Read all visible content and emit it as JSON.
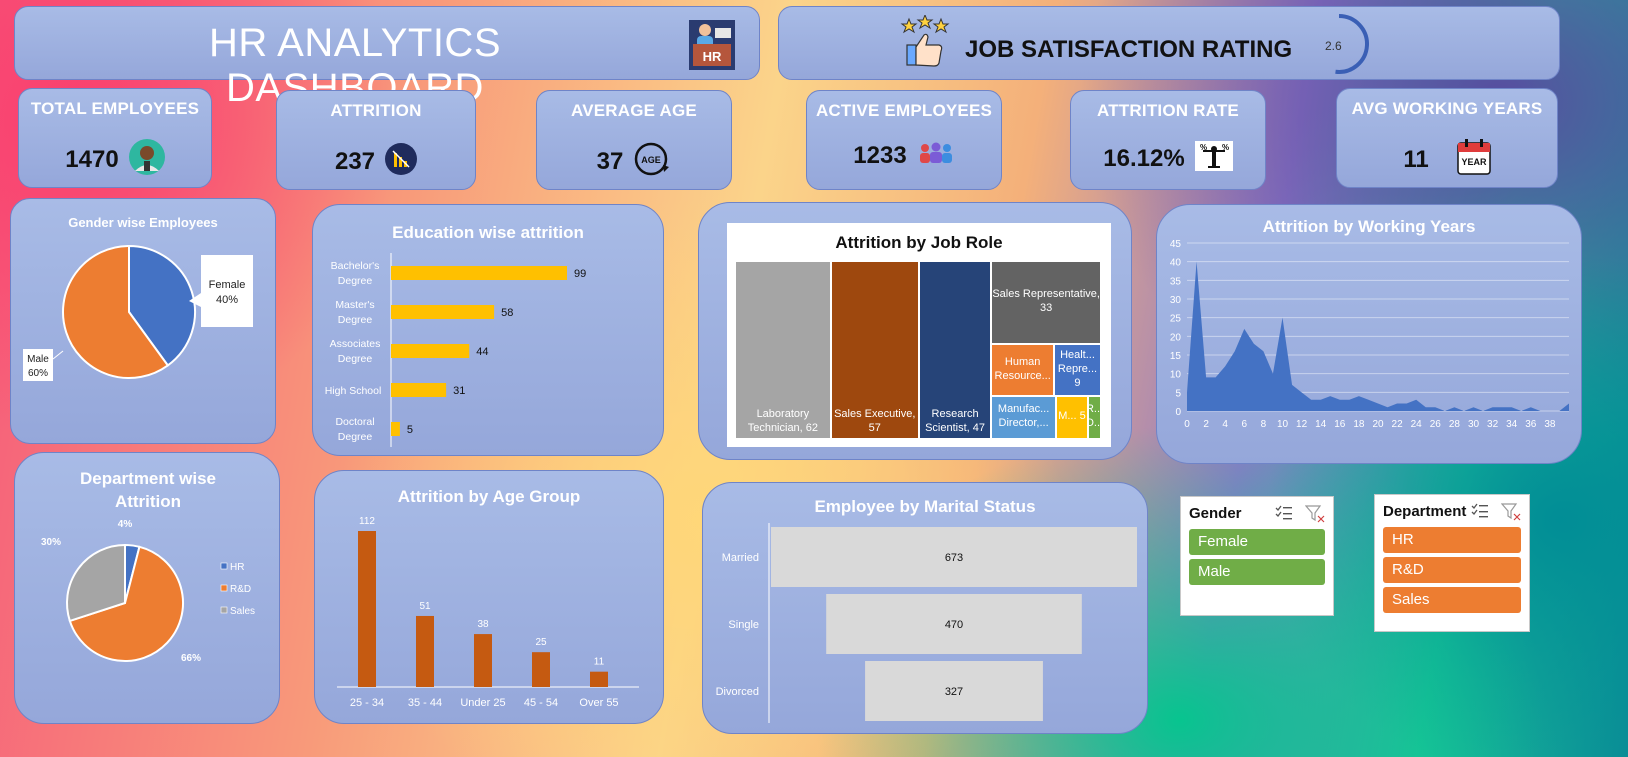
{
  "header": {
    "title": "HR ANALYTICS DASHBOARD",
    "hr_icon_label": "HR",
    "satisfaction_title": "JOB SATISFACTION RATING",
    "satisfaction_value": "2.6",
    "satisfaction_fraction": 0.52
  },
  "kpis": [
    {
      "title": "TOTAL EMPLOYEES",
      "value": "1470",
      "icon": "employee-avatar-icon"
    },
    {
      "title": "ATTRITION",
      "value": "237",
      "icon": "chart-decline-icon"
    },
    {
      "title": "AVERAGE AGE",
      "value": "37",
      "icon": "age-icon",
      "icon_label": "AGE"
    },
    {
      "title": "ACTIVE EMPLOYEES",
      "value": "1233",
      "icon": "people-group-icon"
    },
    {
      "title": "ATTRITION RATE",
      "value": "16.12%",
      "icon": "percent-balance-icon"
    },
    {
      "title": "AVG WORKING YEARS",
      "value": "11",
      "icon": "calendar-year-icon",
      "icon_label": "YEAR"
    }
  ],
  "colors": {
    "blue": "#4472c4",
    "orange": "#ed7d31",
    "gray": "#a5a5a5",
    "gold": "#ffc000",
    "brown": "#c55a11",
    "darkblue": "#264478",
    "rust": "#9e480e",
    "darkgray": "#636363",
    "green": "#70ad47",
    "lightgray": "#d9d9d9",
    "slicer_green": "#70ad47",
    "slicer_orange": "#ed7d31"
  },
  "chart_data": [
    {
      "id": "gender",
      "type": "pie",
      "title": "Gender wise Employees",
      "slices": [
        {
          "name": "Female",
          "value": 40,
          "label": "Female\n40%",
          "color": "#4472c4"
        },
        {
          "name": "Male",
          "value": 60,
          "label": "Male\n60%",
          "color": "#ed7d31"
        }
      ]
    },
    {
      "id": "education",
      "type": "bar",
      "orientation": "horizontal",
      "title": "Education wise attrition",
      "categories": [
        "Bachelor's Degree",
        "Master's Degree",
        "Associates Degree",
        "High School",
        "Doctoral Degree"
      ],
      "values": [
        99,
        58,
        44,
        31,
        5
      ],
      "color": "#ffc000"
    },
    {
      "id": "jobrole",
      "type": "treemap",
      "title": "Attrition by Job Role",
      "items": [
        {
          "name": "Laboratory Technician",
          "value": 62,
          "label": "Laboratory Technician, 62",
          "color": "#a5a5a5"
        },
        {
          "name": "Sales Executive",
          "value": 57,
          "label": "Sales Executive, 57",
          "color": "#9e480e"
        },
        {
          "name": "Research Scientist",
          "value": 47,
          "label": "Research Scientist, 47",
          "color": "#264478"
        },
        {
          "name": "Sales Representative",
          "value": 33,
          "label": "Sales Representative, 33",
          "color": "#636363"
        },
        {
          "name": "Human Resources",
          "value": 12,
          "label": "Human Resource...",
          "color": "#ed7d31"
        },
        {
          "name": "Healthcare Representative",
          "value": 9,
          "label": "Healt... Repre... 9",
          "color": "#4472c4"
        },
        {
          "name": "Manufacturing Director",
          "value": 10,
          "label": "Manufac... Director,...",
          "color": "#5b9bd5"
        },
        {
          "name": "Manager",
          "value": 5,
          "label": "M... 5",
          "color": "#ffc000"
        },
        {
          "name": "Research Director",
          "value": 2,
          "label": "R... D...",
          "color": "#70ad47"
        }
      ]
    },
    {
      "id": "workingyears",
      "type": "area",
      "title": "Attrition by Working Years",
      "x": [
        0,
        1,
        2,
        3,
        4,
        5,
        6,
        7,
        8,
        9,
        10,
        11,
        12,
        13,
        14,
        15,
        16,
        17,
        18,
        19,
        20,
        21,
        22,
        23,
        24,
        25,
        26,
        27,
        28,
        29,
        30,
        31,
        32,
        33,
        34,
        35,
        36,
        37,
        38,
        39,
        40
      ],
      "values": [
        5,
        40,
        9,
        9,
        12,
        16,
        22,
        18,
        16,
        10,
        25,
        7,
        5,
        3,
        3,
        4,
        3,
        3,
        4,
        3,
        2,
        1,
        2,
        2,
        3,
        1,
        1,
        0,
        1,
        0,
        1,
        0,
        1,
        1,
        1,
        0,
        1,
        0,
        0,
        0,
        2
      ],
      "xticks": [
        0,
        2,
        4,
        6,
        8,
        10,
        12,
        14,
        16,
        18,
        20,
        22,
        24,
        26,
        28,
        30,
        32,
        34,
        36,
        38
      ],
      "yticks": [
        0,
        5,
        10,
        15,
        20,
        25,
        30,
        35,
        40,
        45
      ],
      "ylim": [
        0,
        45
      ],
      "color": "#4472c4"
    },
    {
      "id": "department",
      "type": "pie",
      "title": "Department wise Attrition",
      "slices": [
        {
          "name": "HR",
          "value": 4,
          "label": "4%",
          "color": "#4472c4"
        },
        {
          "name": "R&D",
          "value": 66,
          "label": "66%",
          "color": "#ed7d31"
        },
        {
          "name": "Sales",
          "value": 30,
          "label": "30%",
          "color": "#a5a5a5"
        }
      ],
      "legend": [
        "HR",
        "R&D",
        "Sales"
      ],
      "legend_position": "right"
    },
    {
      "id": "agegroup",
      "type": "bar",
      "title": "Attrition by Age Group",
      "categories": [
        "25 - 34",
        "35 - 44",
        "Under 25",
        "45 - 54",
        "Over 55"
      ],
      "values": [
        112,
        51,
        38,
        25,
        11
      ],
      "color": "#c55a11"
    },
    {
      "id": "marital",
      "type": "funnel",
      "title": "Employee by Marital Status",
      "categories": [
        "Married",
        "Single",
        "Divorced"
      ],
      "values": [
        673,
        470,
        327
      ],
      "color": "#d9d9d9"
    }
  ],
  "slicers": {
    "gender": {
      "title": "Gender",
      "items": [
        "Female",
        "Male"
      ]
    },
    "department": {
      "title": "Department",
      "items": [
        "HR",
        "R&D",
        "Sales"
      ]
    }
  }
}
